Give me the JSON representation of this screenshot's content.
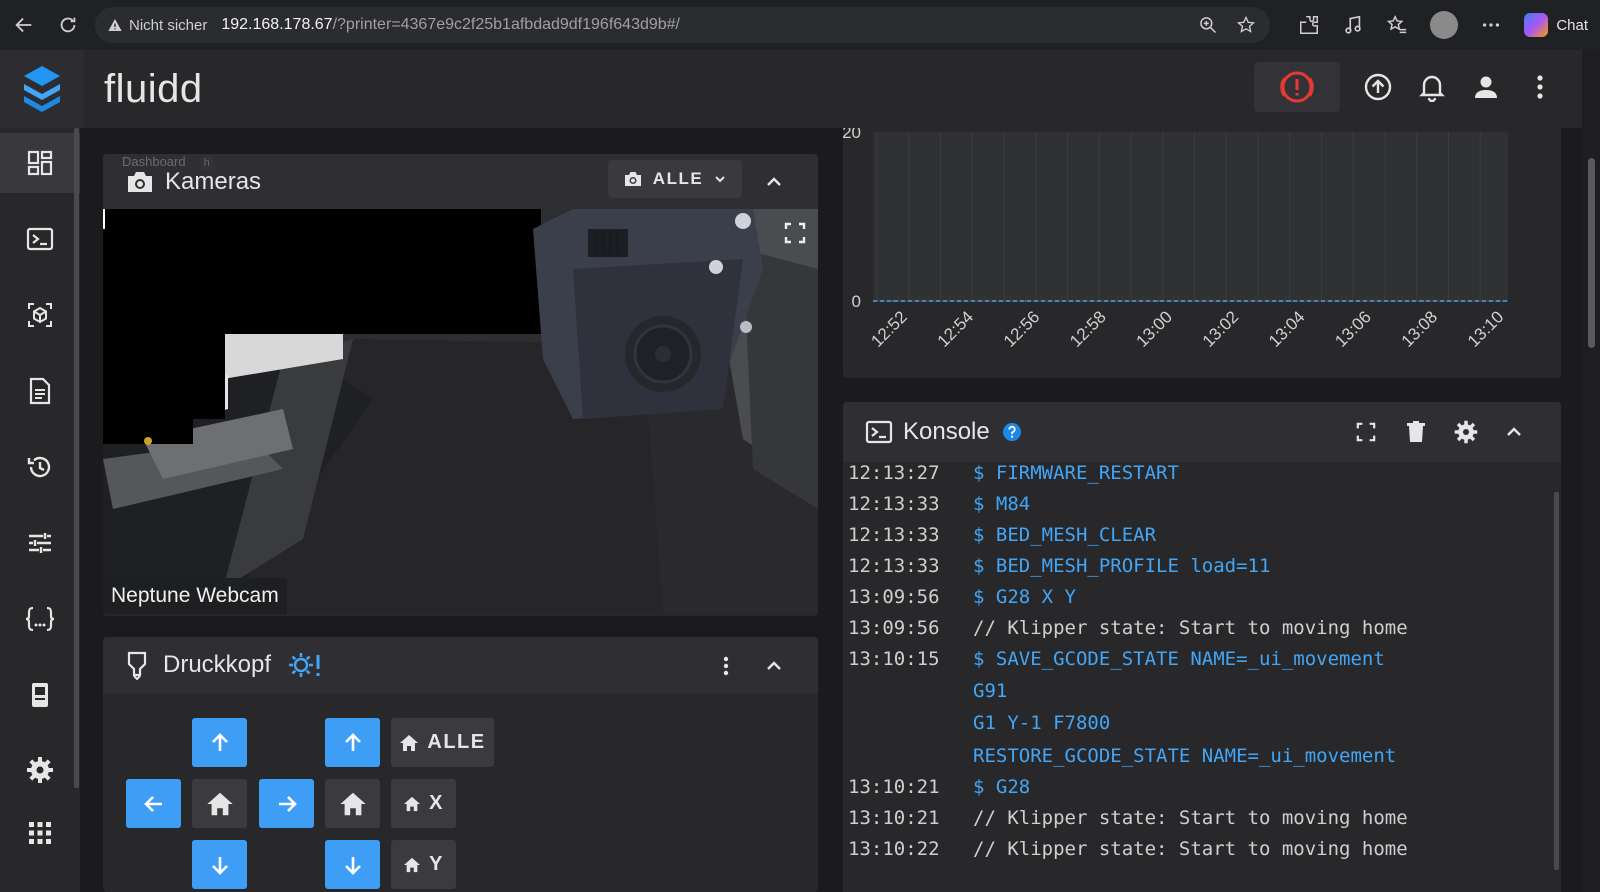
{
  "browser": {
    "warning": "Nicht sicher",
    "url_host": "192.168.178.67",
    "url_path": "/?printer=4367e9c2f25b1afbdad9df196f643d9b#/",
    "chat_label": "Chat"
  },
  "app": {
    "title": "fluidd"
  },
  "tooltip": {
    "text": "Dashboard",
    "key": "h"
  },
  "cameras": {
    "title": "Kameras",
    "filter_label": "ALLE",
    "webcam_name": "Neptune Webcam"
  },
  "toolhead": {
    "title": "Druckkopf",
    "home_all_label": "ALLE",
    "home_x_label": "X",
    "home_y_label": "Y"
  },
  "chart_data": {
    "type": "line",
    "title": "",
    "xlabel": "",
    "ylabel": "",
    "x": [
      "12:52",
      "12:54",
      "12:56",
      "12:58",
      "13:00",
      "13:02",
      "13:04",
      "13:06",
      "13:08",
      "13:10"
    ],
    "y_ticks": [
      "20",
      "0"
    ],
    "ylim": [
      0,
      20
    ],
    "series": [
      {
        "values": [
          0,
          0,
          0,
          0,
          0,
          0,
          0,
          0,
          0,
          0
        ],
        "color": "#42a5f5"
      }
    ],
    "grid": true
  },
  "console": {
    "title": "Konsole",
    "rows": [
      {
        "time": "12:13:27",
        "cmd": "$ FIRMWARE_RESTART",
        "kind": "cmd"
      },
      {
        "time": "12:13:33",
        "cmd": "$ M84",
        "kind": "cmd"
      },
      {
        "time": "12:13:33",
        "cmd": "$ BED_MESH_CLEAR",
        "kind": "cmd"
      },
      {
        "time": "12:13:33",
        "cmd": "$ BED_MESH_PROFILE load=11",
        "kind": "cmd"
      },
      {
        "time": "13:09:56",
        "cmd": "$ G28 X Y",
        "kind": "cmd"
      },
      {
        "time": "13:09:56",
        "cmd": "// Klipper state: Start to moving home",
        "kind": "msg"
      },
      {
        "time": "13:10:15",
        "cmd": "$ SAVE_GCODE_STATE NAME=_ui_movement",
        "kind": "cmd"
      },
      {
        "time": "",
        "cmd": "G91",
        "kind": "cmd"
      },
      {
        "time": "",
        "cmd": "G1 Y-1 F7800",
        "kind": "cmd"
      },
      {
        "time": "",
        "cmd": "RESTORE_GCODE_STATE NAME=_ui_movement",
        "kind": "cmd"
      },
      {
        "time": "13:10:21",
        "cmd": "$ G28",
        "kind": "cmd"
      },
      {
        "time": "13:10:21",
        "cmd": "// Klipper state: Start to moving home",
        "kind": "msg"
      },
      {
        "time": "13:10:22",
        "cmd": "// Klipper state: Start to moving home",
        "kind": "msg"
      }
    ]
  },
  "colors": {
    "accent": "#42a5f5",
    "jog_blue": "#3e9ef5",
    "estop_red": "#e53935"
  }
}
